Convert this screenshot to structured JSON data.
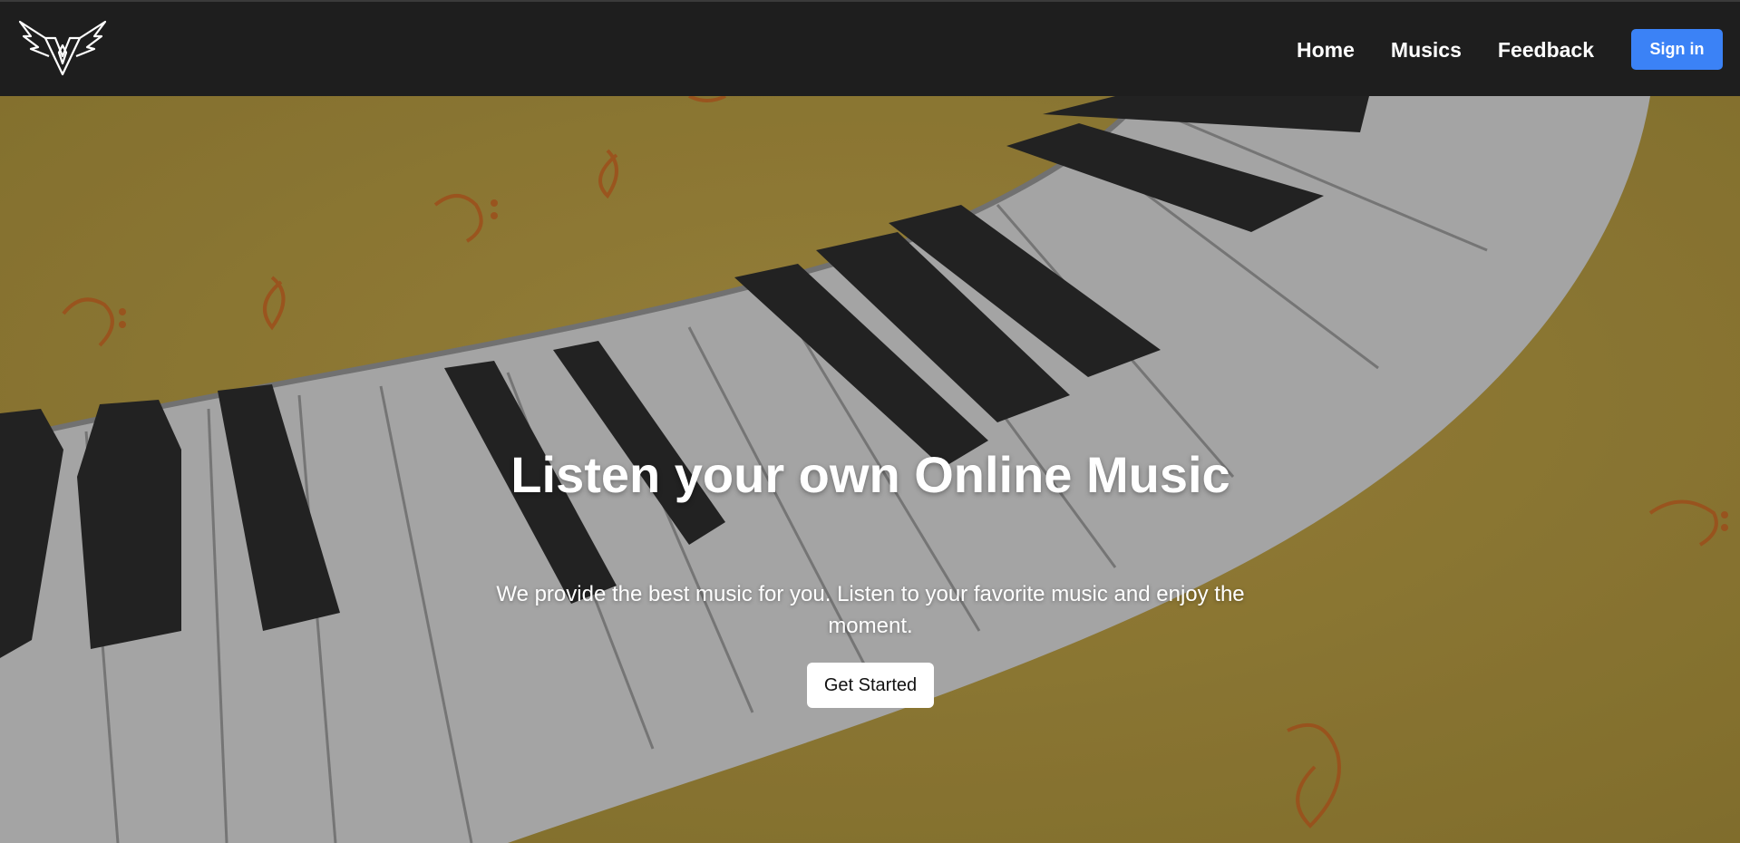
{
  "nav": {
    "logo_icon": "winged-v-logo-icon",
    "links": [
      {
        "label": "Home"
      },
      {
        "label": "Musics"
      },
      {
        "label": "Feedback"
      }
    ],
    "signin_label": "Sign in"
  },
  "hero": {
    "background_image": "curved-piano-keyboard-on-golden-background-with-music-notes",
    "title": "Listen your own Online Music",
    "subtitle": "We provide the best music for you. Listen to your favorite music and enjoy the moment.",
    "cta_label": "Get Started"
  },
  "colors": {
    "navbar_bg": "#1e1e1e",
    "accent": "#3b82f6",
    "hero_bg": "#a08a3a"
  }
}
